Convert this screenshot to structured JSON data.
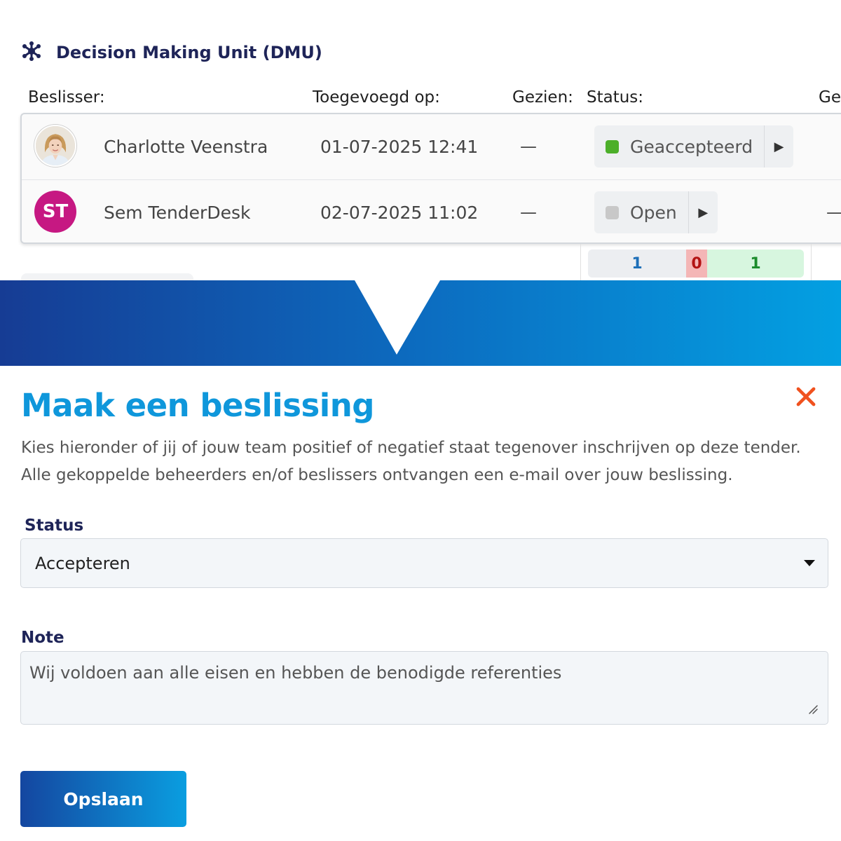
{
  "dmu": {
    "title": "Decision Making Unit (DMU)",
    "icon": "network-nodes-icon"
  },
  "table": {
    "headers": {
      "decider": "Beslisser:",
      "added_on": "Toegevoegd op:",
      "seen": "Gezien:",
      "status": "Status:",
      "extra": "Ger"
    },
    "rows": [
      {
        "avatar": "person-photo",
        "name": "Charlotte Veenstra",
        "added_on": "01-07-2025 12:41",
        "seen": "—",
        "status": "Geaccepteerd",
        "status_color": "#4caf2a"
      },
      {
        "avatar_initials": "ST",
        "avatar_color": "#c61882",
        "name": "Sem TenderDesk",
        "added_on": "02-07-2025 11:02",
        "seen": "—",
        "status": "Open",
        "status_color": "#c8c8c8",
        "extra": "—"
      }
    ],
    "counts": {
      "open": "1",
      "rejected": "0",
      "accepted": "1"
    }
  },
  "modal": {
    "title": "Maak een beslissing",
    "description": "Kies hieronder of jij of jouw team positief of negatief staat tegenover inschrijven op deze tender. Alle gekoppelde beheerders en/of beslissers ontvangen een e-mail over jouw beslissing.",
    "status_label": "Status",
    "status_value": "Accepteren",
    "note_label": "Note",
    "note_value": "Wij voldoen aan alle eisen en hebben de benodigde referenties",
    "save_label": "Opslaan"
  },
  "colors": {
    "brand_navy": "#1e2458",
    "brand_blue": "#0f97db",
    "close": "#f0511e"
  }
}
